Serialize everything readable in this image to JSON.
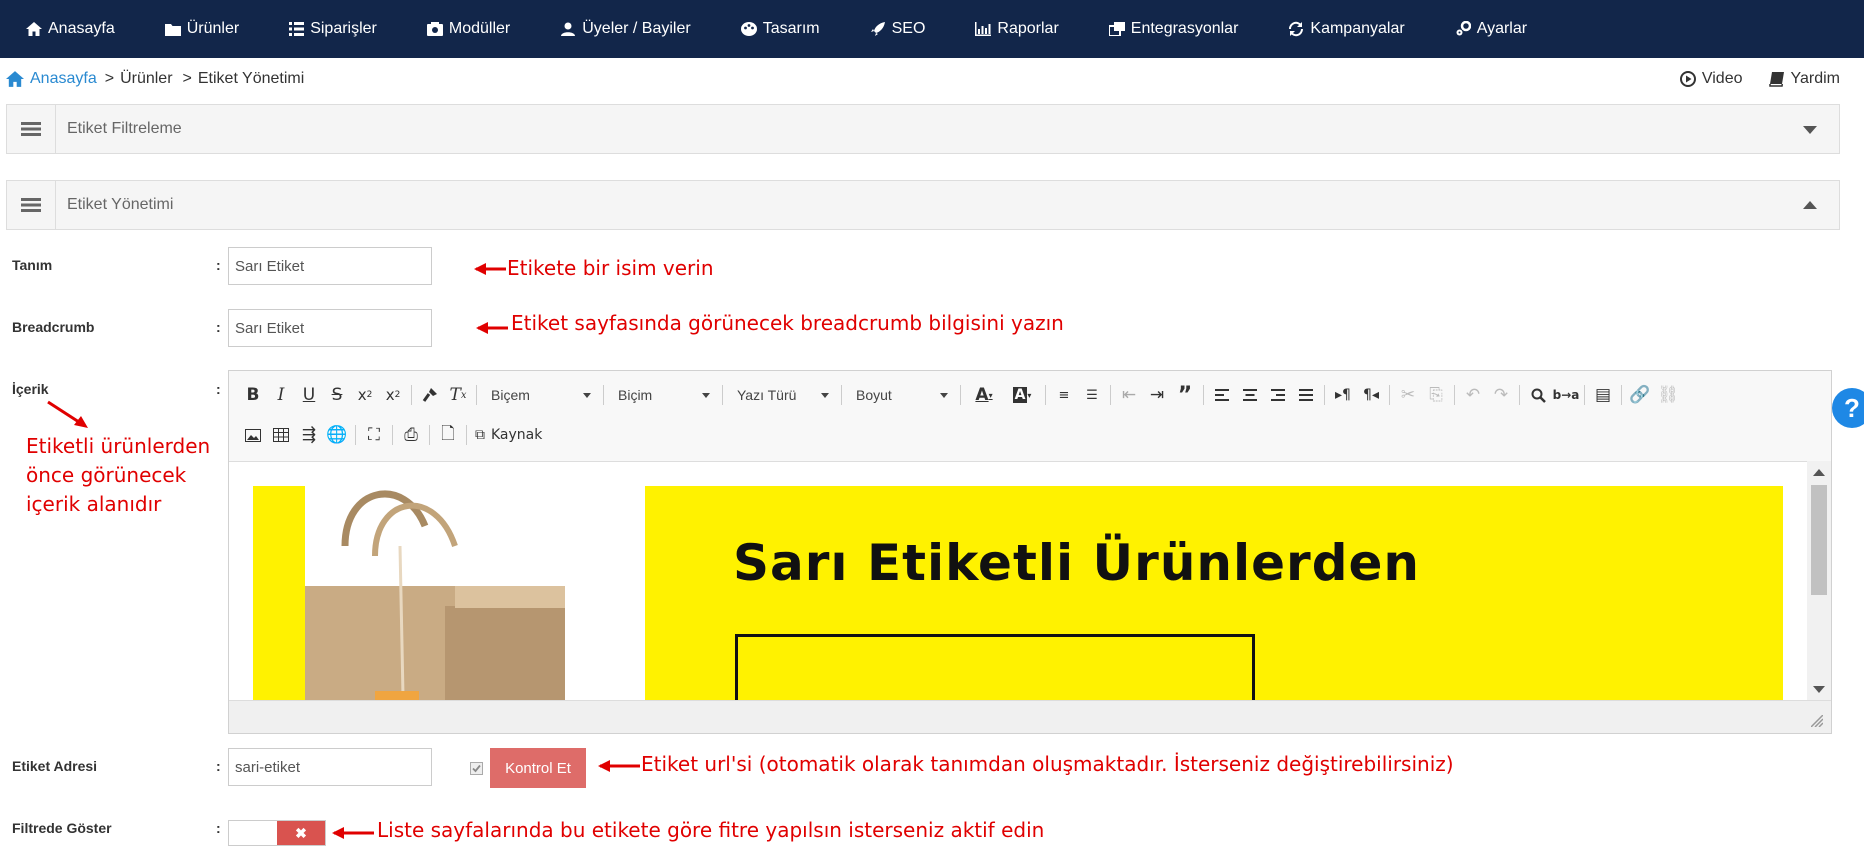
{
  "nav": {
    "items": [
      {
        "label": "Anasayfa",
        "icon": "home-icon"
      },
      {
        "label": "Ürünler",
        "icon": "folder-icon"
      },
      {
        "label": "Siparişler",
        "icon": "list-icon"
      },
      {
        "label": "Modüller",
        "icon": "module-icon"
      },
      {
        "label": "Üyeler / Bayiler",
        "icon": "users-icon"
      },
      {
        "label": "Tasarım",
        "icon": "palette-icon"
      },
      {
        "label": "SEO",
        "icon": "rocket-icon"
      },
      {
        "label": "Raporlar",
        "icon": "chart-icon"
      },
      {
        "label": "Entegrasyonlar",
        "icon": "windows-icon"
      },
      {
        "label": "Kampanyalar",
        "icon": "refresh-icon"
      },
      {
        "label": "Ayarlar",
        "icon": "gears-icon"
      }
    ],
    "bg": "#12264a"
  },
  "breadcrumb": {
    "home": "Anasayfa",
    "sep1": ">",
    "level1": "Ürünler",
    "sep2": ">",
    "current": "Etiket Yönetimi"
  },
  "toplinks": {
    "video": "Video",
    "help": "Yardim"
  },
  "panels": {
    "filter_title": "Etiket Filtreleme",
    "manage_title": "Etiket Yönetimi"
  },
  "form": {
    "colon": ":",
    "tanim_label": "Tanım",
    "tanim_value": "Sarı Etiket",
    "breadcrumb_label": "Breadcrumb",
    "breadcrumb_value": "Sarı Etiket",
    "icerik_label": "İçerik",
    "adres_label": "Etiket Adresi",
    "adres_value": "sari-etiket",
    "check_button": "Kontrol Et",
    "filter_label": "Filtrede Göster",
    "toggle_state": "off"
  },
  "editor": {
    "combos": [
      "Biçem",
      "Biçim",
      "Yazı Türü",
      "Boyut"
    ],
    "source_label": "Kaynak",
    "banner_text": "Sarı Etiketli Ürünlerden",
    "banner_color": "#fff200"
  },
  "annotations": {
    "tanim": "Etikete bir isim verin",
    "breadcrumb": "Etiket sayfasında görünecek breadcrumb bilgisini yazın",
    "icerik_1": "Etiketli ürünlerden",
    "icerik_2": "önce görünecek",
    "icerik_3": "içerik alanıdır",
    "adres": "Etiket url'si (otomatik olarak tanımdan oluşmaktadır. İsterseniz değiştirebilirsiniz)",
    "filter": "Liste sayfalarında bu etikete göre fitre yapılsın isterseniz aktif edin",
    "color": "#e00000"
  },
  "help_button": "?"
}
